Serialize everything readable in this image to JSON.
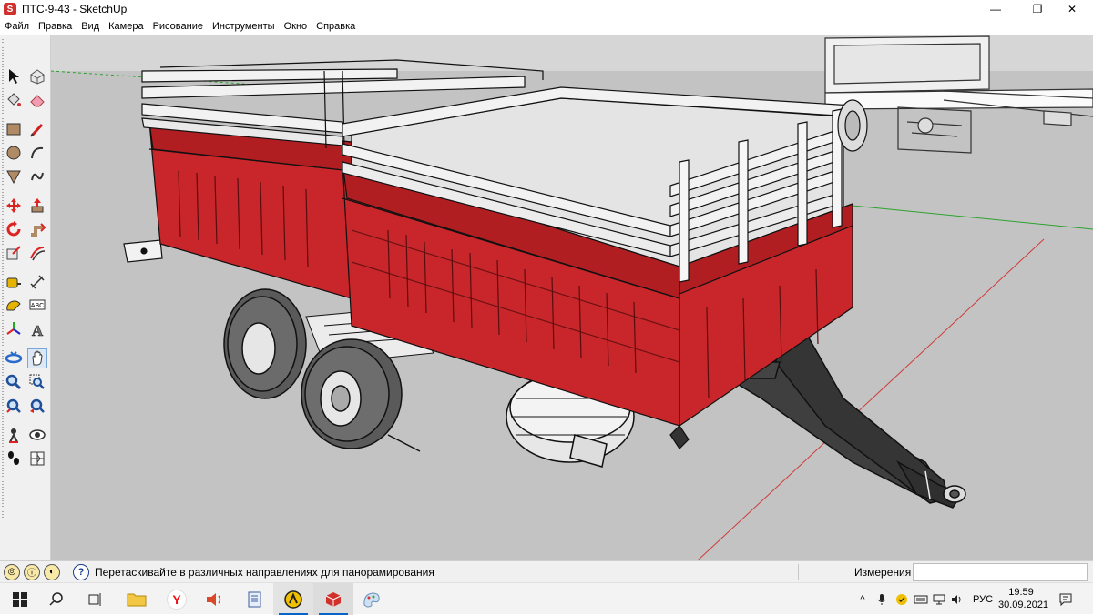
{
  "window": {
    "title": "ПТС-9-43 - SketchUp",
    "app_icon_letter": "S",
    "minimize": "—",
    "maximize": "❐",
    "close": "✕"
  },
  "menu": [
    "Файл",
    "Правка",
    "Вид",
    "Камера",
    "Рисование",
    "Инструменты",
    "Окно",
    "Справка"
  ],
  "toolbar": {
    "tools": [
      "select-tool",
      "make-component-tool",
      "paint-bucket-tool",
      "eraser-tool",
      "rectangle-tool",
      "line-tool",
      "circle-tool",
      "arc-tool",
      "polygon-tool",
      "freehand-tool",
      "move-tool",
      "push-pull-tool",
      "rotate-tool",
      "follow-me-tool",
      "scale-tool",
      "offset-tool",
      "tape-measure-tool",
      "dimension-tool",
      "protractor-tool",
      "text-tool",
      "axes-tool",
      "3d-text-tool",
      "orbit-tool",
      "pan-tool",
      "zoom-tool",
      "zoom-window-tool",
      "zoom-extents-tool",
      "previous-view-tool",
      "position-camera-tool",
      "look-around-tool",
      "walk-tool",
      "section-plane-tool"
    ],
    "text_tool_label": "ABC",
    "text3d_label": "A"
  },
  "statusbar": {
    "hint": "Перетаскивайте в различных направлениях для панорамирования",
    "measurements_label": "Измерения",
    "measurements_value": "",
    "help_glyph": "?"
  },
  "taskbar": {
    "lang": "РУС",
    "time": "19:59",
    "date": "30.09.2021",
    "yandex_letter": "Y"
  },
  "colors": {
    "trailer_red": "#c8262a",
    "rails": "#f2f2f2",
    "chassis": "#3b3b3b",
    "ground": "#c3c3c3"
  }
}
